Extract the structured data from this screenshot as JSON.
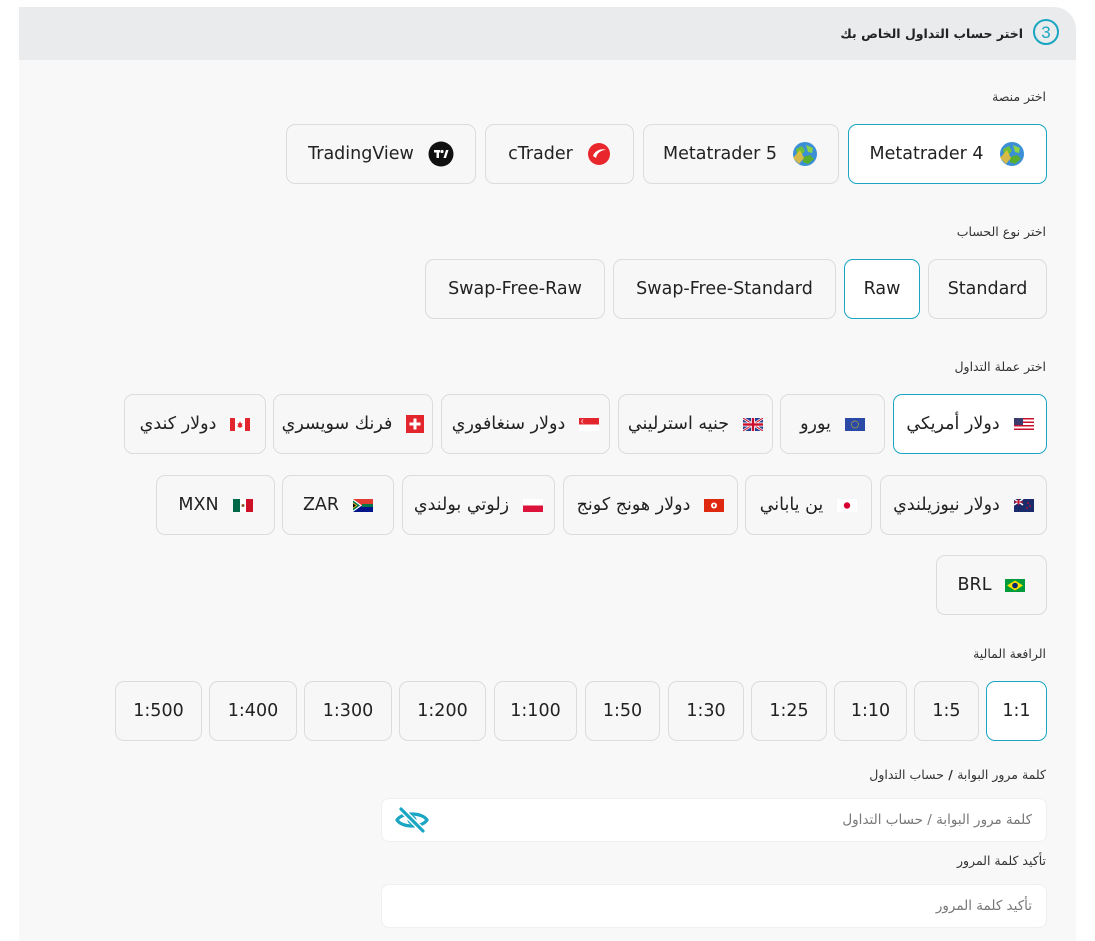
{
  "header": {
    "step": "3",
    "title": "اختر حساب التداول الخاص بك"
  },
  "platform": {
    "label": "اختر منصة",
    "options": [
      {
        "label": "Metatrader 4",
        "icon": "metatrader-globe-icon",
        "selected": true
      },
      {
        "label": "Metatrader 5",
        "icon": "metatrader-globe-icon",
        "selected": false
      },
      {
        "label": "cTrader",
        "icon": "ctrader-logo-icon",
        "selected": false
      },
      {
        "label": "TradingView",
        "icon": "tradingview-logo-icon",
        "selected": false
      }
    ]
  },
  "account_type": {
    "label": "اختر نوع الحساب",
    "options": [
      {
        "label": "Standard",
        "selected": false
      },
      {
        "label": "Raw",
        "selected": true
      },
      {
        "label": "Swap-Free-Standard",
        "selected": false
      },
      {
        "label": "Swap-Free-Raw",
        "selected": false
      }
    ]
  },
  "currency": {
    "label": "اختر عملة التداول",
    "options": [
      {
        "label": "دولار أمريكي",
        "flag": "us",
        "selected": true
      },
      {
        "label": "يورو",
        "flag": "eu",
        "selected": false
      },
      {
        "label": "جنيه استرليني",
        "flag": "gb",
        "selected": false
      },
      {
        "label": "دولار سنغافوري",
        "flag": "sg",
        "selected": false
      },
      {
        "label": "فرنك سويسري",
        "flag": "ch",
        "selected": false
      },
      {
        "label": "دولار كندي",
        "flag": "ca",
        "selected": false
      },
      {
        "label": "دولار نيوزيلندي",
        "flag": "nz",
        "selected": false
      },
      {
        "label": "ين ياباني",
        "flag": "jp",
        "selected": false
      },
      {
        "label": "دولار هونج كونج",
        "flag": "hk",
        "selected": false
      },
      {
        "label": "زلوتي بولندي",
        "flag": "pl",
        "selected": false
      },
      {
        "label": "ZAR",
        "flag": "za",
        "selected": false
      },
      {
        "label": "MXN",
        "flag": "mx",
        "selected": false
      },
      {
        "label": "BRL",
        "flag": "br",
        "selected": false
      }
    ]
  },
  "leverage": {
    "label": "الرافعة المالية",
    "options": [
      {
        "label": "1:1",
        "selected": true
      },
      {
        "label": "1:5",
        "selected": false
      },
      {
        "label": "1:10",
        "selected": false
      },
      {
        "label": "1:25",
        "selected": false
      },
      {
        "label": "1:30",
        "selected": false
      },
      {
        "label": "1:50",
        "selected": false
      },
      {
        "label": "1:100",
        "selected": false
      },
      {
        "label": "1:200",
        "selected": false
      },
      {
        "label": "1:300",
        "selected": false
      },
      {
        "label": "1:400",
        "selected": false
      },
      {
        "label": "1:500",
        "selected": false
      }
    ]
  },
  "password": {
    "label_main": "كلمة مرور البوابة",
    "label_sep": " / ",
    "label_rest": "حساب التداول",
    "placeholder": "كلمة مرور البوابة / حساب التداول",
    "toggle_icon": "eye-slash-icon"
  },
  "confirm_password": {
    "label": "تأكيد كلمة المرور",
    "placeholder": "تأكيد كلمة المرور"
  },
  "colors": {
    "accent": "#1aa6c2",
    "header_bg": "#eaebed",
    "panel_bg": "#f8f8f9"
  }
}
